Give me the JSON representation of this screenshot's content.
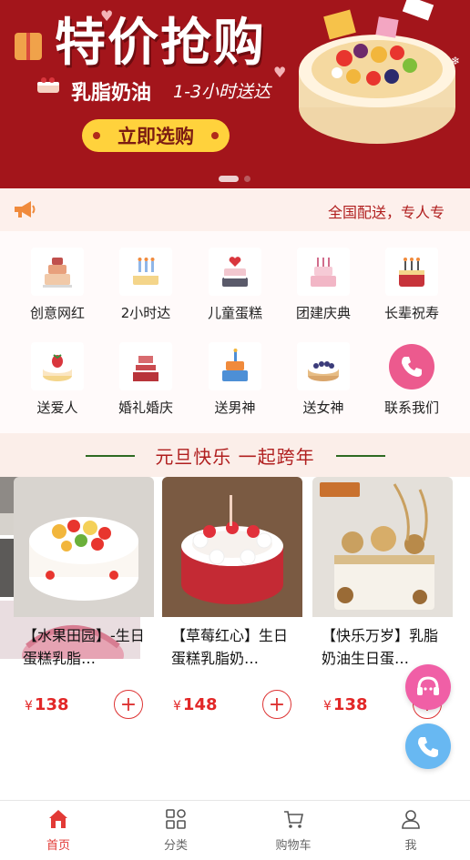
{
  "banner": {
    "title": "特价抢购",
    "subtitle_left": "乳脂奶油",
    "subtitle_right": "1-3小时送达",
    "cta_label": "立即选购",
    "slides": 2,
    "active_slide": 1
  },
  "notice": {
    "icon": "megaphone-icon",
    "text": "全国配送，专人专"
  },
  "categories": [
    {
      "label": "创意网红",
      "icon": "cake-tiered-icon"
    },
    {
      "label": "2小时达",
      "icon": "cake-candles-icon"
    },
    {
      "label": "儿童蛋糕",
      "icon": "cake-heart-icon"
    },
    {
      "label": "团建庆典",
      "icon": "cake-pink-icon"
    },
    {
      "label": "长辈祝寿",
      "icon": "cake-red-icon"
    },
    {
      "label": "送爱人",
      "icon": "cake-strawberry-icon"
    },
    {
      "label": "婚礼婚庆",
      "icon": "cake-wedding-icon"
    },
    {
      "label": "送男神",
      "icon": "cake-blue-icon"
    },
    {
      "label": "送女神",
      "icon": "cake-berry-icon"
    },
    {
      "label": "联系我们",
      "icon": "phone-icon"
    }
  ],
  "section": {
    "title": "元旦快乐 一起跨年"
  },
  "products": [
    {
      "name": "【水果田园】-生日蛋糕乳脂…",
      "currency": "¥",
      "price": "138"
    },
    {
      "name": "【草莓红心】生日蛋糕乳脂奶…",
      "currency": "¥",
      "price": "148"
    },
    {
      "name": "【快乐万岁】乳脂奶油生日蛋…",
      "currency": "¥",
      "price": "138"
    }
  ],
  "floating": {
    "service_icon": "customer-service-icon",
    "phone_icon": "phone-call-icon"
  },
  "tabbar": [
    {
      "label": "首页",
      "icon": "home-icon",
      "active": true
    },
    {
      "label": "分类",
      "icon": "category-icon",
      "active": false
    },
    {
      "label": "购物车",
      "icon": "cart-icon",
      "active": false
    },
    {
      "label": "我",
      "icon": "user-icon",
      "active": false
    }
  ],
  "colors": {
    "brand_red": "#a3151b",
    "accent_red": "#e23a36",
    "cta_yellow": "#ffd23c",
    "price_red": "#e22727"
  }
}
